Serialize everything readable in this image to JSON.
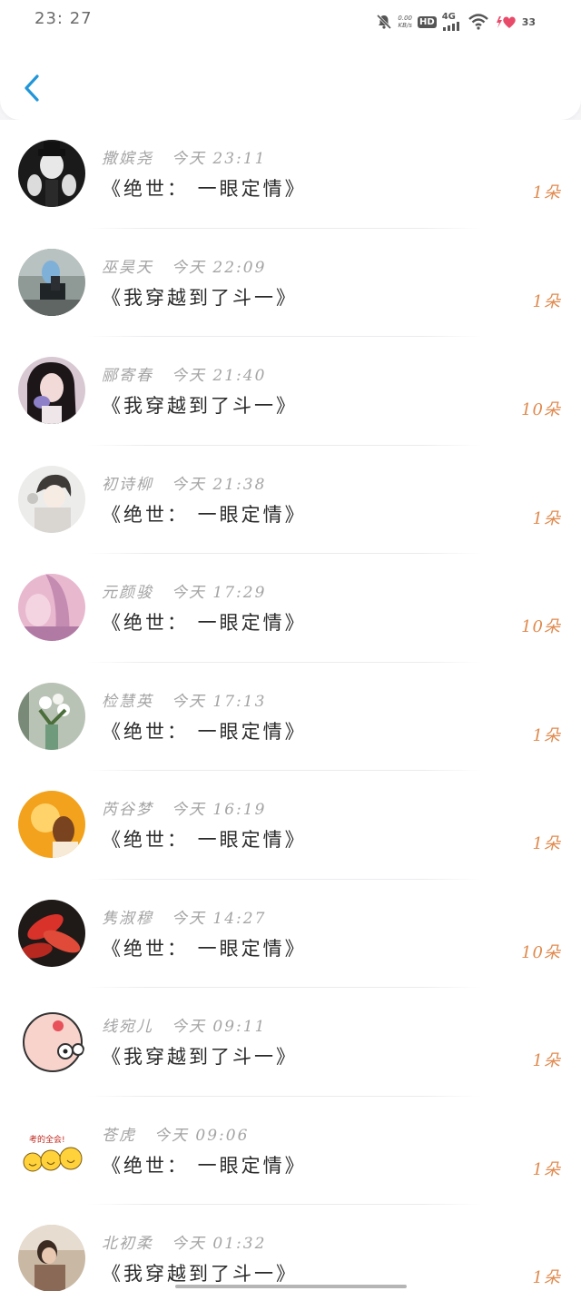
{
  "status_bar": {
    "time": "23: 27",
    "speed_value": "0.00",
    "speed_unit": "KB/s",
    "hd": "HD",
    "network": "4G",
    "battery": "33"
  },
  "list": [
    {
      "name": "撒嫔尧",
      "time": "今天 23:11",
      "title": "《绝世： 一眼定情》",
      "count": "1朵",
      "avatar": "mime"
    },
    {
      "name": "巫昊天",
      "time": "今天 22:09",
      "title": "《我穿越到了斗一》",
      "count": "1朵",
      "avatar": "selfie"
    },
    {
      "name": "郦寄春",
      "time": "今天 21:40",
      "title": "《我穿越到了斗一》",
      "count": "10朵",
      "avatar": "girl"
    },
    {
      "name": "初诗柳",
      "time": "今天 21:38",
      "title": "《绝世： 一眼定情》",
      "count": "1朵",
      "avatar": "anime"
    },
    {
      "name": "元颜骏",
      "time": "今天 17:29",
      "title": "《绝世： 一眼定情》",
      "count": "10朵",
      "avatar": "pink"
    },
    {
      "name": "检慧英",
      "time": "今天 17:13",
      "title": "《绝世： 一眼定情》",
      "count": "1朵",
      "avatar": "flowers"
    },
    {
      "name": "芮谷梦",
      "time": "今天 16:19",
      "title": "《绝世： 一眼定情》",
      "count": "1朵",
      "avatar": "sunset"
    },
    {
      "name": "隽淑穆",
      "time": "今天 14:27",
      "title": "《绝世： 一眼定情》",
      "count": "10朵",
      "avatar": "leaves"
    },
    {
      "name": "线宛儿",
      "time": "今天 09:11",
      "title": "《我穿越到了斗一》",
      "count": "1朵",
      "avatar": "cartoon"
    },
    {
      "name": "苍虎",
      "time": "今天 09:06",
      "title": "《绝世： 一眼定情》",
      "count": "1朵",
      "avatar": "emoji",
      "avatar_caption": "考的全会!"
    },
    {
      "name": "北初柔",
      "time": "今天 01:32",
      "title": "《我穿越到了斗一》",
      "count": "1朵",
      "avatar": "sitting"
    }
  ],
  "colors": {
    "accent_blue": "#2196d9",
    "count_orange": "#e08a4e"
  },
  "icons": {
    "back": "chevron-left-icon",
    "mute": "bell-off-icon",
    "wifi": "wifi-icon",
    "signal": "signal-icon",
    "battery": "heart-battery-icon"
  }
}
